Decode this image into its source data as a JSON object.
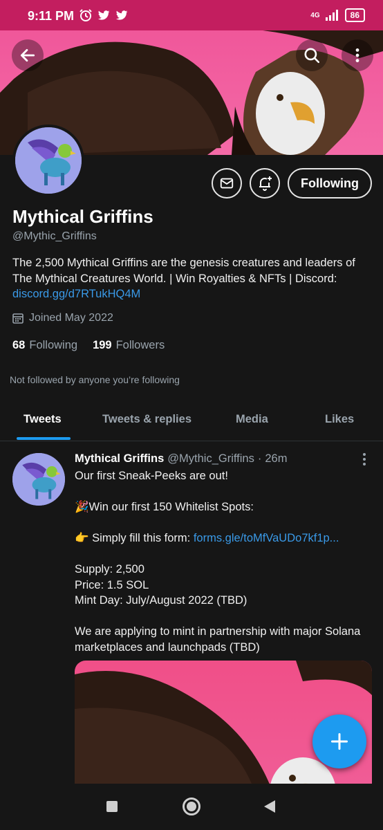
{
  "status_bar": {
    "time": "9:11 PM",
    "left_icons": [
      "alarm-icon",
      "twitter-icon",
      "twitter-icon"
    ],
    "network": "4G",
    "battery": "86"
  },
  "colors": {
    "status_bar": "#c31e5f",
    "banner_pink": "#f0579a",
    "background": "#161616",
    "accent_blue": "#1d9bf0",
    "link": "#3a9ae8",
    "secondary_text": "#9aa4ad"
  },
  "header": {
    "back_icon": "arrow-left-icon",
    "search_icon": "search-icon",
    "more_icon": "more-vertical-icon"
  },
  "profile": {
    "name": "Mythical Griffins",
    "handle": "@Mythic_Griffins",
    "bio_text": "The 2,500 Mythical Griffins are the genesis creatures and leaders of The Mythical Creatures World. | Win Royalties & NFTs | Discord: ",
    "bio_link": "discord.gg/d7RTukHQ4M",
    "joined": "Joined May 2022",
    "following_count": "68",
    "following_label": "Following",
    "followers_count": "199",
    "followers_label": "Followers",
    "not_followed": "Not followed by anyone you’re following",
    "following_button": "Following"
  },
  "tabs": [
    {
      "label": "Tweets",
      "active": true
    },
    {
      "label": "Tweets & replies",
      "active": false
    },
    {
      "label": "Media",
      "active": false
    },
    {
      "label": "Likes",
      "active": false
    }
  ],
  "tweet": {
    "author": "Mythical Griffins",
    "handle": "@Mythic_Griffins",
    "separator": "·",
    "time": "26m",
    "line1": "Our first Sneak-Peeks are out!",
    "line2": "🎉Win our first 150 Whitelist Spots:",
    "line3_prefix": "👉 Simply fill this form: ",
    "line3_link": "forms.gle/toMfVaUDo7kf1p...",
    "line4": "Supply: 2,500",
    "line5": "Price: 1.5 SOL",
    "line6": "Mint Day: July/August 2022 (TBD)",
    "line7": "We are applying to mint in partnership with major Solana marketplaces and launchpads (TBD)"
  },
  "fab_icon": "plus-icon",
  "nav": [
    "recents-icon",
    "home-icon",
    "back-icon"
  ]
}
